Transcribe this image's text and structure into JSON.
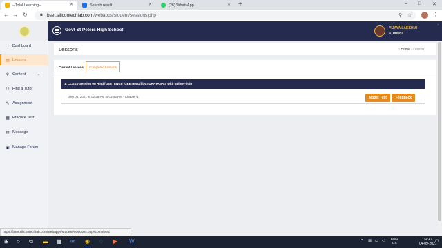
{
  "browser": {
    "tabs": [
      {
        "title": "--Total Learning--",
        "fav_color": "#f0b400"
      },
      {
        "title": "Search result",
        "fav_color": "#1a73e8"
      },
      {
        "title": "(26) WhatsApp",
        "fav_color": "#25d366"
      }
    ],
    "url_host": "bset.silicontechlab.com",
    "url_path": "/webapps/student/sessions.php"
  },
  "header": {
    "school_name": "Govt St Peters High School",
    "user_name": "VIJAYA LAKSHMI",
    "user_role": "STUDENT"
  },
  "sidebar": {
    "items": [
      {
        "label": "Dashboard",
        "icon": "dashboard-icon",
        "glyph": "◔"
      },
      {
        "label": "Lessons",
        "icon": "lessons-icon",
        "glyph": "▤"
      },
      {
        "label": "Content",
        "icon": "search-icon",
        "glyph": "⚲"
      },
      {
        "label": "Find a Tutor",
        "icon": "user-icon",
        "glyph": "⚇"
      },
      {
        "label": "Assignment",
        "icon": "pencil-icon",
        "glyph": "✎"
      },
      {
        "label": "Practice Test",
        "icon": "test-icon",
        "glyph": "▦"
      },
      {
        "label": "Message",
        "icon": "envelope-icon",
        "glyph": "✉"
      },
      {
        "label": "Manage Forum",
        "icon": "forum-icon",
        "glyph": "▣"
      }
    ]
  },
  "page": {
    "title": "Lessons",
    "breadcrumb_home": "Home",
    "breadcrumb_current": "Lesson"
  },
  "lesson_tabs": [
    "Current Lessons",
    "Completed Lessons"
  ],
  "lesson": {
    "title": "1. CLASS-Session on Hindi[GEETENGI] [GEETENGI] by,SURAYANA S with online-- join",
    "time": "Sep 04, 2021 at 02:35 PM to 03:45 PM - Chapter-1",
    "model_test_label": "Model Test",
    "feedback_label": "Feedback"
  },
  "status_link": "https://bset.silicontechlab.com/webapps/student/sessions.php#completed",
  "taskbar": {
    "lang_top": "ENG",
    "lang_bottom": "US",
    "time": "14:47",
    "date": "04-09-2021"
  }
}
